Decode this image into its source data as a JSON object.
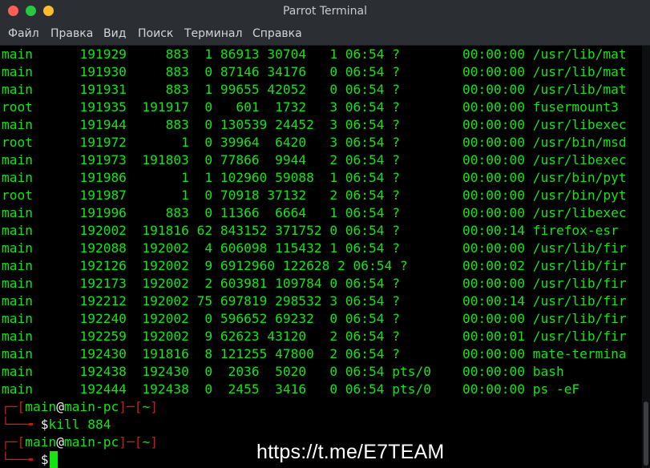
{
  "window": {
    "title": "Parrot Terminal"
  },
  "menu": [
    "Файл",
    "Правка",
    "Вид",
    "Поиск",
    "Терминал",
    "Справка"
  ],
  "process_rows": [
    "main      191929     883  1 86913 30704   1 06:54 ?        00:00:00 /usr/lib/mat",
    "main      191930     883  0 87146 34176   0 06:54 ?        00:00:00 /usr/lib/mat",
    "main      191931     883  1 99655 42052   0 06:54 ?        00:00:00 /usr/lib/mat",
    "root      191935  191917  0   601  1732   3 06:54 ?        00:00:00 fusermount3",
    "main      191944     883  0 130539 24452  3 06:54 ?        00:00:00 /usr/libexec",
    "root      191972       1  0 39964  6420   3 06:54 ?        00:00:00 /usr/bin/msd",
    "main      191973  191803  0 77866  9944   2 06:54 ?        00:00:00 /usr/libexec",
    "main      191986       1  1 102960 59088  1 06:54 ?        00:00:00 /usr/bin/pyt",
    "root      191987       1  0 70918 37132   2 06:54 ?        00:00:00 /usr/bin/pyt",
    "main      191996     883  0 11366  6664   1 06:54 ?        00:00:00 /usr/libexec",
    "main      192002  191816 62 843152 371752 0 06:54 ?        00:00:14 firefox-esr",
    "main      192088  192002  4 606098 115432 1 06:54 ?        00:00:00 /usr/lib/fir",
    "main      192126  192002  9 6912960 122628 2 06:54 ?       00:00:02 /usr/lib/fir",
    "main      192173  192002  2 603981 109784 0 06:54 ?        00:00:00 /usr/lib/fir",
    "main      192212  192002 75 697819 298532 3 06:54 ?        00:00:14 /usr/lib/fir",
    "main      192240  192002  0 596652 69232  0 06:54 ?        00:00:00 /usr/lib/fir",
    "main      192259  192002  9 62623 43120   2 06:54 ?        00:00:01 /usr/lib/fir",
    "main      192430  191816  8 121255 47800  2 06:54 ?        00:00:00 mate-termina",
    "main      192438  192430  0  2036  5020   0 06:54 pts/0    00:00:00 bash",
    "main      192444  192438  0  2455  3416   0 06:54 pts/0    00:00:00 ps -eF"
  ],
  "prompt": {
    "corner_top": "┌─",
    "open_bracket": "[",
    "user": "main",
    "at": "@",
    "host": "main-pc",
    "close_bracket": "]",
    "dash": "─",
    "dir_open": "[",
    "dir": "~",
    "dir_close": "]",
    "corner_bottom": "└──╼ ",
    "dollar": "$"
  },
  "commands": {
    "first": "kill 884",
    "second": ""
  },
  "watermark": "https://t.me/E7TEAM",
  "colors": {
    "terminal_text": "#14e414",
    "prompt_bracket": "#d01818",
    "background": "#000000"
  }
}
